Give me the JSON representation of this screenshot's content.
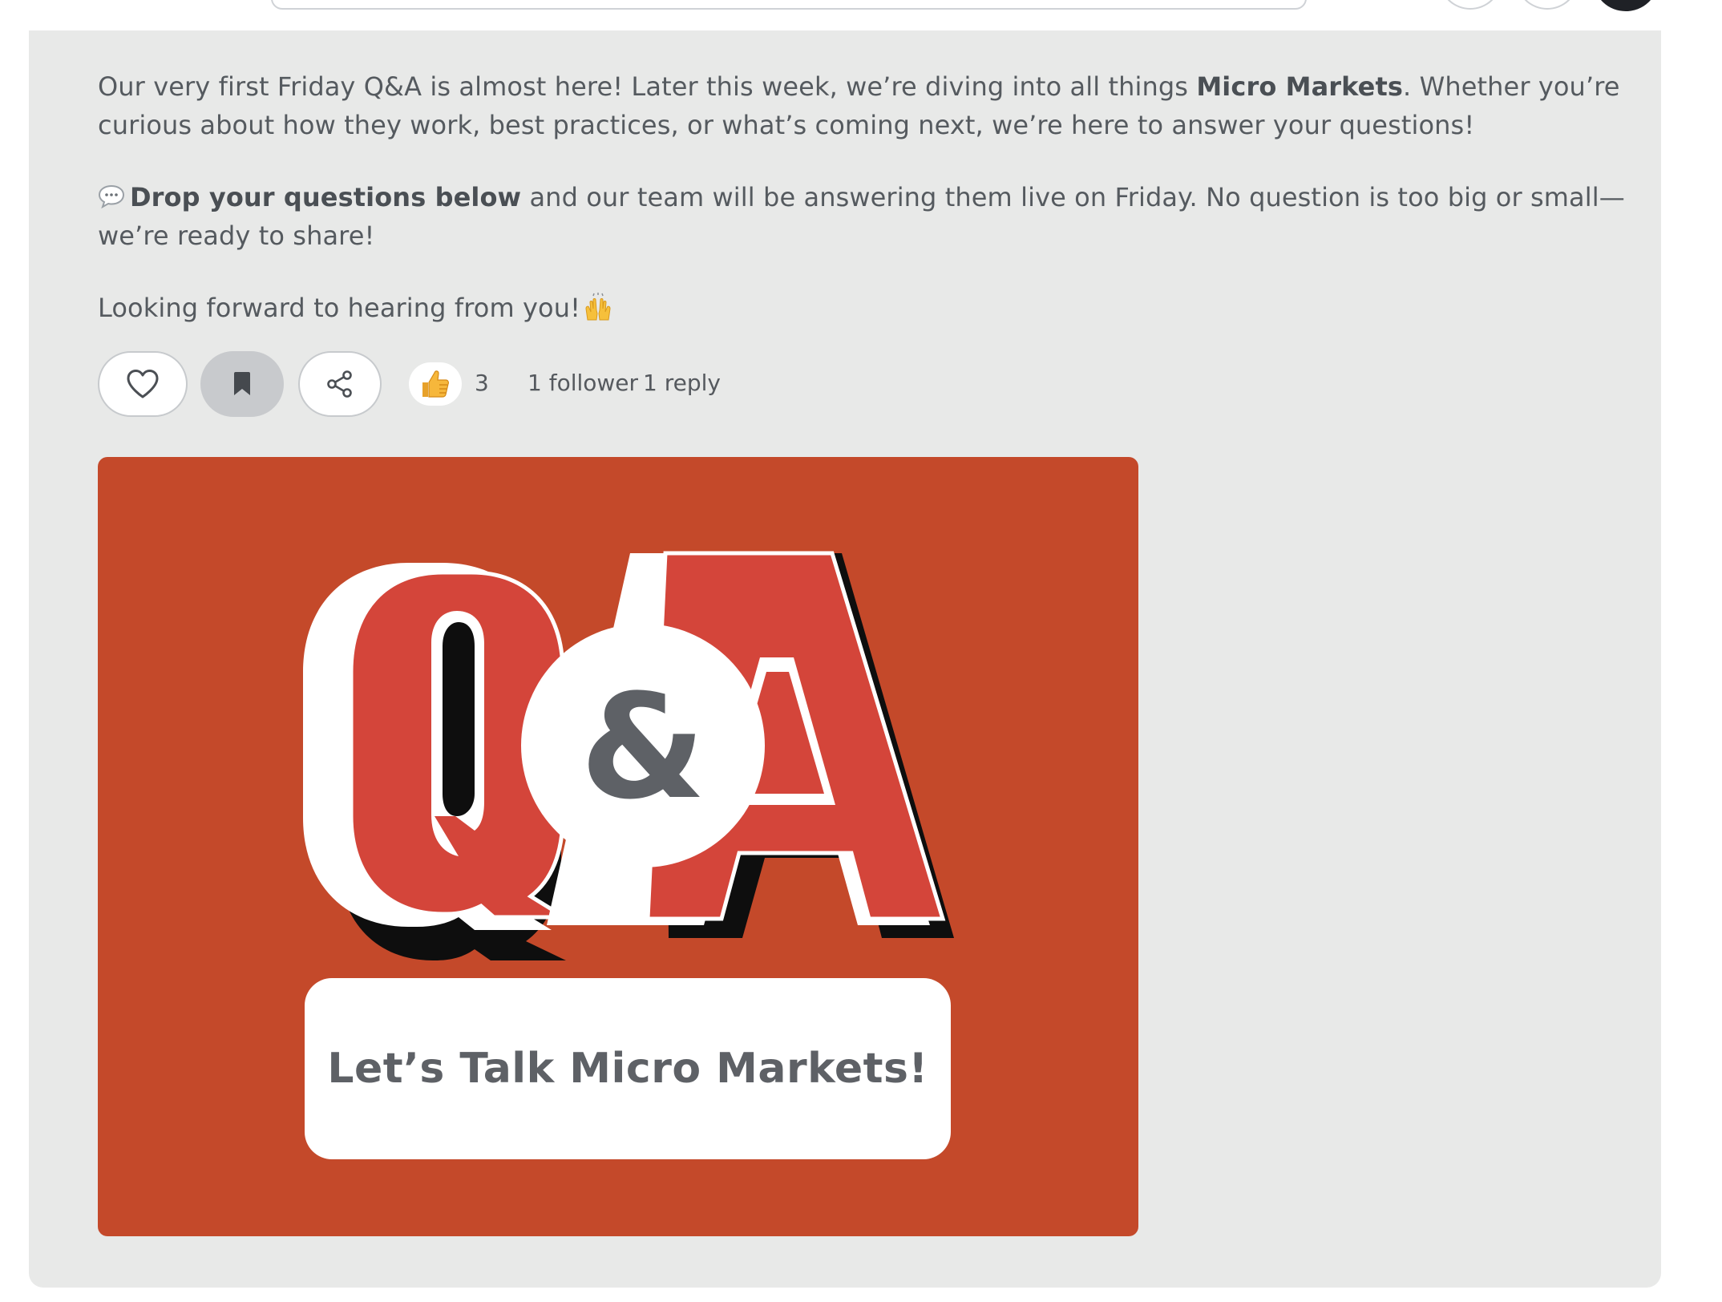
{
  "post": {
    "p1_a": "Our very first Friday Q&A is almost here! Later this week, we’re diving into all things ",
    "p1_bold": "Micro Markets",
    "p1_b": ". Whether you’re curious about how they work, best practices, or what’s coming next, we’re here to answer your questions!",
    "p2_bold": "Drop your questions below",
    "p2_rest": " and our team will be answering them live on Friday. No question is too big or small—we’re ready to share!",
    "p3": "Looking forward to hearing from you!"
  },
  "actions": {
    "reaction_count": "3",
    "followers": "1 follower",
    "replies": "1 reply"
  },
  "image": {
    "banner_text": "Let’s Talk Micro Markets!",
    "ampersand": "&"
  },
  "colors": {
    "card_bg": "#e8e9e8",
    "image_bg": "#c4492a",
    "letter_red": "#d4453a"
  },
  "icons": {
    "like": "heart-icon",
    "bookmark": "bookmark-icon",
    "share": "share-icon",
    "reaction": "thumbs-up-emoji",
    "speech": "speech-bubble-emoji",
    "celebrate": "raising-hands-emoji"
  }
}
